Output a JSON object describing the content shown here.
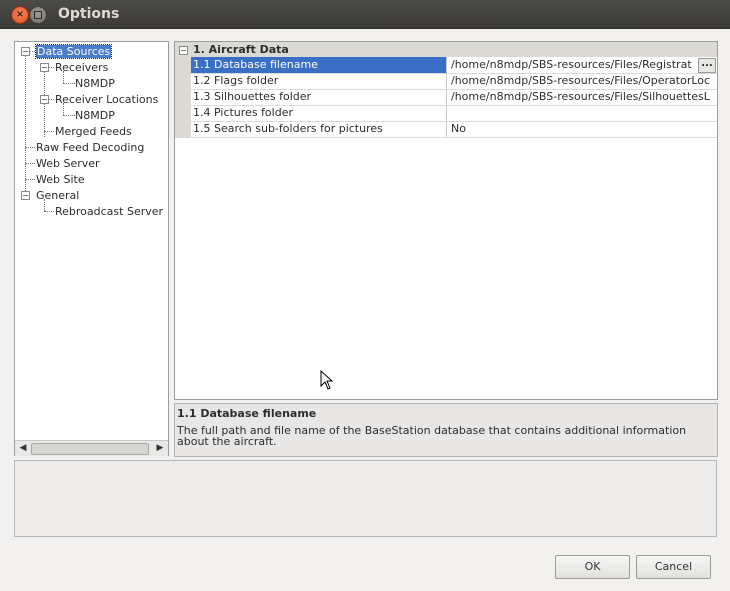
{
  "window": {
    "title": "Options"
  },
  "tree": {
    "items": [
      {
        "label": "Data Sources",
        "selected": true
      },
      {
        "label": "Receivers"
      },
      {
        "label": "N8MDP"
      },
      {
        "label": "Receiver Locations"
      },
      {
        "label": "N8MDP"
      },
      {
        "label": "Merged Feeds"
      },
      {
        "label": "Raw Feed Decoding"
      },
      {
        "label": "Web Server"
      },
      {
        "label": "Web Site"
      },
      {
        "label": "General"
      },
      {
        "label": "Rebroadcast Server"
      }
    ]
  },
  "grid": {
    "category": "1. Aircraft Data",
    "rows": [
      {
        "name": "1.1 Database filename",
        "value": "/home/n8mdp/SBS-resources/Files/Registrat"
      },
      {
        "name": "1.2 Flags folder",
        "value": "/home/n8mdp/SBS-resources/Files/OperatorLoc"
      },
      {
        "name": "1.3 Silhouettes folder",
        "value": "/home/n8mdp/SBS-resources/Files/SilhouettesL"
      },
      {
        "name": "1.4 Pictures folder",
        "value": ""
      },
      {
        "name": "1.5 Search sub-folders for pictures",
        "value": "No"
      }
    ],
    "browse_label": "..."
  },
  "description": {
    "title": "1.1 Database filename",
    "text": "The full path and file name of the BaseStation database that contains additional information about the aircraft."
  },
  "buttons": {
    "ok": "OK",
    "cancel": "Cancel"
  },
  "icons": {
    "close": "close-icon",
    "maximize": "maximize-icon"
  }
}
